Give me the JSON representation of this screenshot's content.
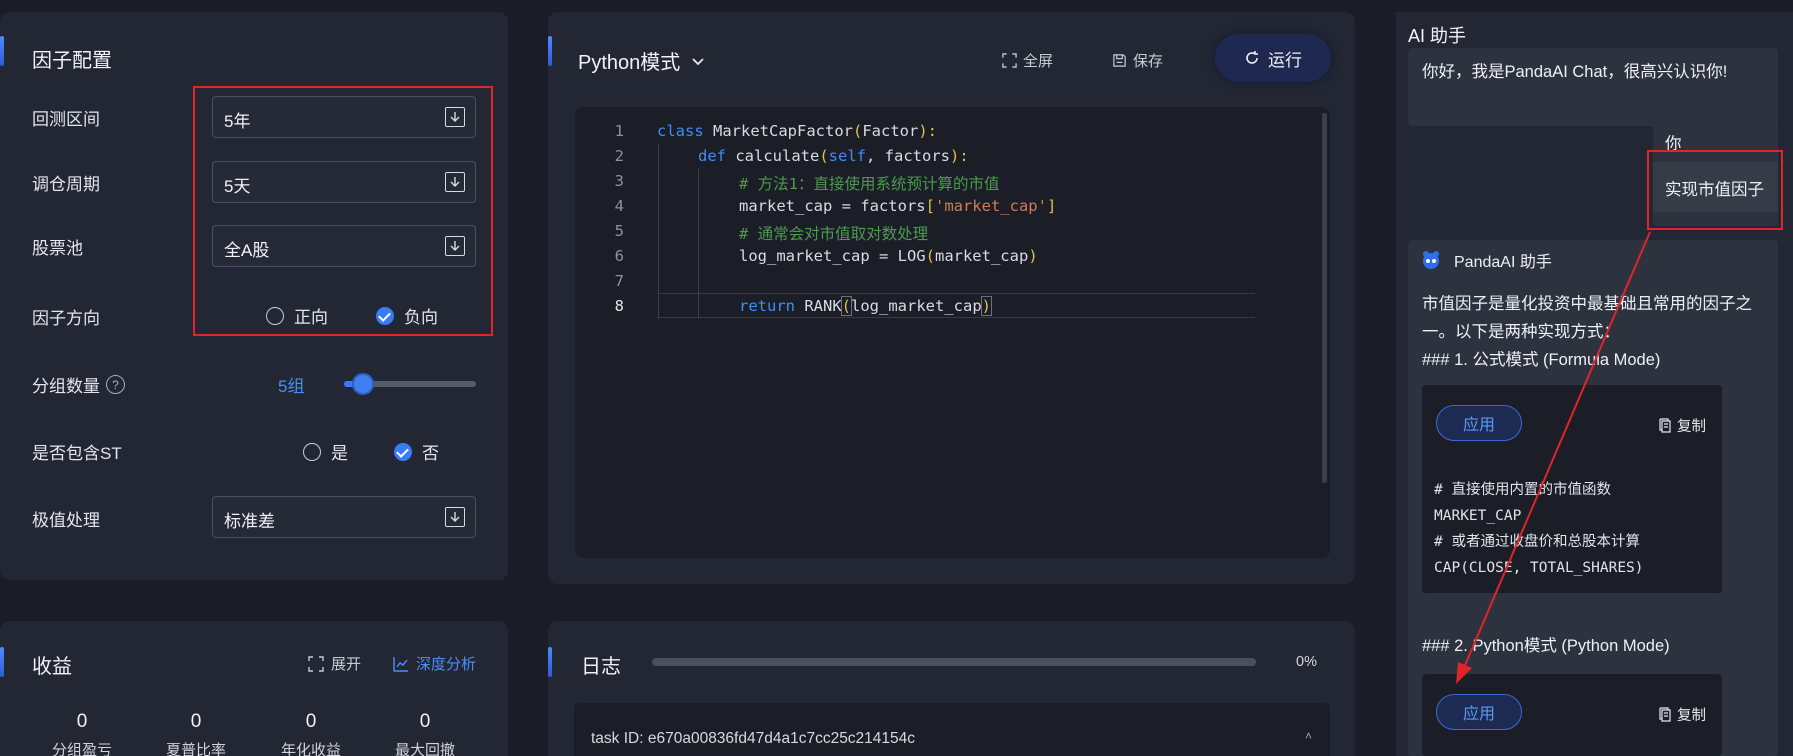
{
  "factor_config": {
    "title": "因子配置",
    "backtest_label": "回测区间",
    "backtest_value": "5年",
    "rebalance_label": "调仓周期",
    "rebalance_value": "5天",
    "pool_label": "股票池",
    "pool_value": "全A股",
    "direction_label": "因子方向",
    "direction_pos": "正向",
    "direction_neg": "负向",
    "groups_label": "分组数量",
    "groups_value": "5组",
    "groups_help": "?",
    "st_label": "是否包含ST",
    "st_yes": "是",
    "st_no": "否",
    "extreme_label": "极值处理",
    "extreme_value": "标准差"
  },
  "editor": {
    "mode": "Python模式",
    "fullscreen": "全屏",
    "save": "保存",
    "run": "运行",
    "lines": [
      "1",
      "2",
      "3",
      "4",
      "5",
      "6",
      "7",
      "8"
    ],
    "code": {
      "l1_kw": "class",
      "l1_rest": " MarketCapFactor",
      "l1_paren": "(",
      "l1_arg": "Factor",
      "l1_end": "):",
      "l2_kw": "def",
      "l2_name": " calculate",
      "l2_paren": "(",
      "l2_self": "self",
      "l2_rest": ", factors",
      "l2_end": "):",
      "l3": "# 方法1：直接使用系统预计算的市值",
      "l4_a": "market_cap = factors",
      "l4_b": "[",
      "l4_str": "'market_cap'",
      "l4_c": "]",
      "l5": "# 通常会对市值取对数处理",
      "l6_a": "log_market_cap = LOG",
      "l6_b": "(",
      "l6_c": "market_cap",
      "l6_d": ")",
      "l8_kw": "return",
      "l8_a": " RANK",
      "l8_b": "(",
      "l8_c": "log_market_cap",
      "l8_d": ")"
    }
  },
  "returns": {
    "title": "收益",
    "expand": "展开",
    "deep": "深度分析",
    "stats": [
      {
        "value": "0",
        "label": "分组盈亏"
      },
      {
        "value": "0",
        "label": "夏普比率"
      },
      {
        "value": "0",
        "label": "年化收益"
      },
      {
        "value": "0",
        "label": "最大回撤"
      }
    ]
  },
  "log": {
    "title": "日志",
    "progress_text": "0%",
    "progress": 0,
    "task_id": "task ID: e670a00836fd47d4a1c7cc25c214154c"
  },
  "assistant": {
    "title": "AI 助手",
    "greeting": "你好，我是PandaAI Chat，很高兴认识你!",
    "user_label": "你",
    "user_message": "实现市值因子",
    "bot_name": "PandaAI 助手",
    "reply_line1": "市值因子是量化投资中最基础且常用的因子之",
    "reply_line2": "一。以下是两种实现方式：",
    "reply_h1": "### 1. 公式模式 (Formula Mode)",
    "apply": "应用",
    "copy": "复制",
    "code1": [
      "# 直接使用内置的市值函数",
      "MARKET_CAP",
      "# 或者通过收盘价和总股本计算",
      "CAP(CLOSE, TOTAL_SHARES)"
    ],
    "reply_h2": "### 2. Python模式 (Python Mode)"
  },
  "colors": {
    "accent": "#3a7bf5",
    "annotation": "#e0242a",
    "panel": "#232733"
  }
}
